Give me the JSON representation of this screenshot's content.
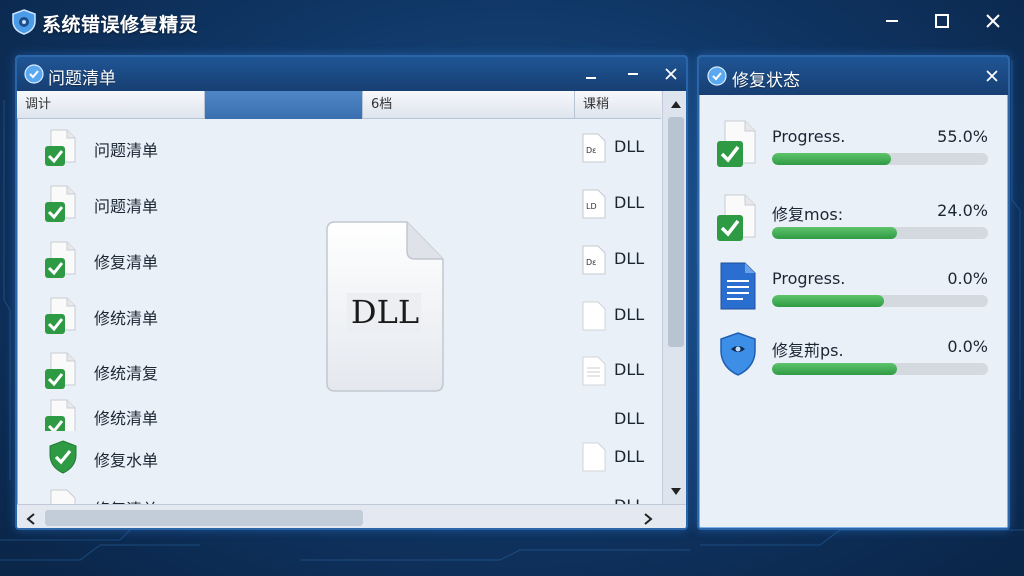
{
  "app": {
    "title": "系统错误修复精灵"
  },
  "colors": {
    "background": "#0f3462",
    "panel_header": "#1f5595",
    "panel_body": "#eaf0f8",
    "progress_fill": "#3aa84c",
    "check_green": "#2f9a44"
  },
  "issue_panel": {
    "title": "问题清单",
    "columns": [
      "调计",
      "",
      "6档",
      "课稍"
    ],
    "rows": [
      {
        "name": "问题清单",
        "file_icon_text": "Dε",
        "type": "DLL",
        "icon": "document-check-icon"
      },
      {
        "name": "问题清单",
        "file_icon_text": "LD",
        "type": "DLL",
        "icon": "document-check-icon"
      },
      {
        "name": "修复清单",
        "file_icon_text": "Dε",
        "type": "DLL",
        "icon": "document-check-icon"
      },
      {
        "name": "修统清单",
        "file_icon_text": "",
        "type": "DLL",
        "icon": "document-check-icon"
      },
      {
        "name": "修统清复",
        "file_icon_text": "",
        "type": "DLL",
        "icon": "document-check-icon"
      },
      {
        "name": "修统清单",
        "file_icon_text": "",
        "type": "DLL",
        "icon": "document-check-icon"
      },
      {
        "name": "修复水单",
        "file_icon_text": "",
        "type": "DLL",
        "icon": "shield-check-icon"
      },
      {
        "name": "修复清单",
        "file_icon_text": "",
        "type": "DLL",
        "icon": "document-icon"
      }
    ],
    "preview": {
      "label": "DLL"
    }
  },
  "status_panel": {
    "title": "修复状态",
    "items": [
      {
        "label": "Progress.",
        "value": "55.0%",
        "progress": 0.55,
        "icon": "document-check-icon"
      },
      {
        "label": "修复mos:",
        "value": "24.0%",
        "progress": 0.58,
        "icon": "document-check-icon"
      },
      {
        "label": "Progress.",
        "value": "0.0%",
        "progress": 0.52,
        "icon": "text-document-icon"
      },
      {
        "label": "修复荊ps.",
        "value": "0.0%",
        "progress": 0.58,
        "icon": "shield-icon"
      }
    ]
  }
}
